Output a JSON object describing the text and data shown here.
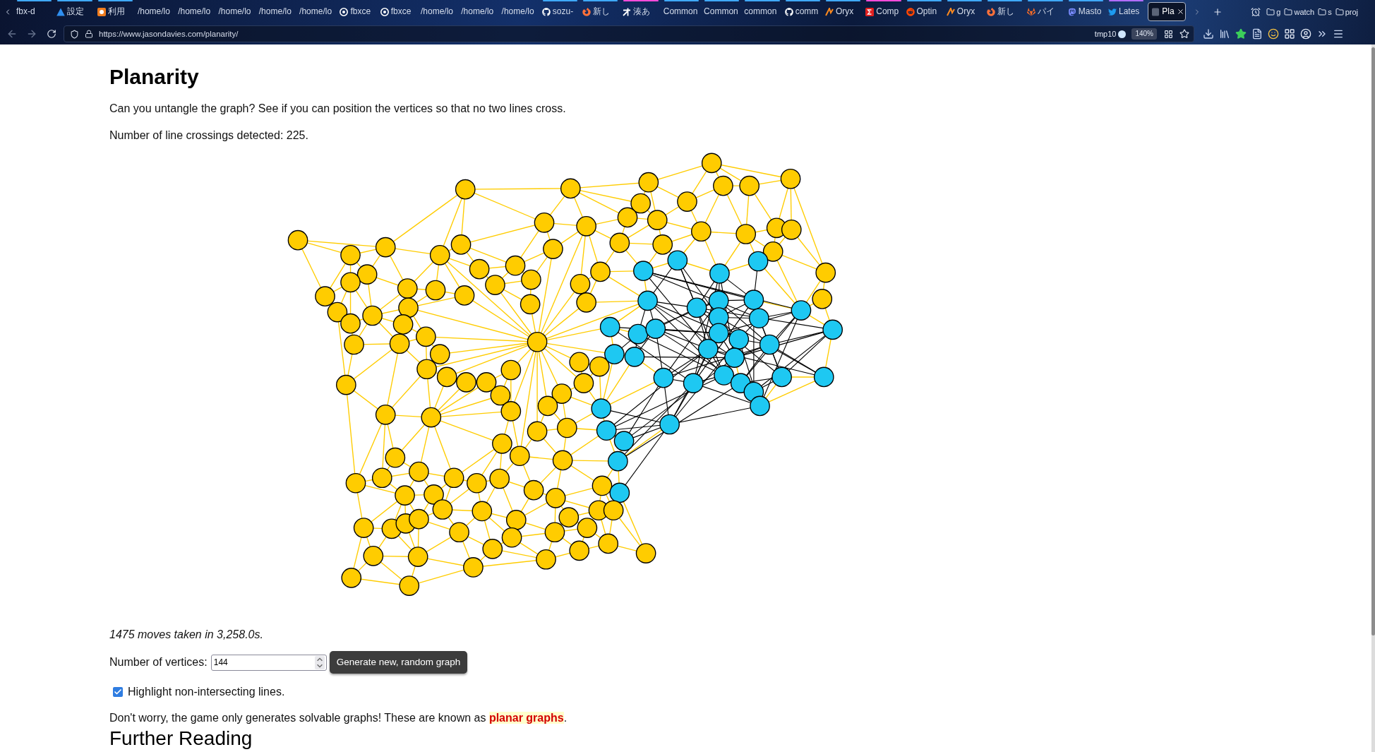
{
  "browser": {
    "tabs": [
      {
        "label": "fbx-d",
        "selected": false,
        "color": "#3fa9ff"
      },
      {
        "label": "設定",
        "selected": false,
        "color": "#3fa9ff"
      },
      {
        "label": "利用",
        "selected": false,
        "color": "#3fa9ff"
      },
      {
        "label": "/home/lo",
        "selected": false
      },
      {
        "label": "/home/lo",
        "selected": false
      },
      {
        "label": "/home/lo",
        "selected": false
      },
      {
        "label": "/home/lo",
        "selected": false
      },
      {
        "label": "/home/lo",
        "selected": false
      },
      {
        "label": "fbxce",
        "selected": false
      },
      {
        "label": "fbxce",
        "selected": false
      },
      {
        "label": "/home/lo",
        "selected": false
      },
      {
        "label": "/home/lo",
        "selected": false
      },
      {
        "label": "/home/lo",
        "selected": false
      },
      {
        "label": "sozu-",
        "selected": false,
        "color": "#3fa9ff"
      },
      {
        "label": "新し",
        "selected": false,
        "color": "#3fa9ff"
      },
      {
        "label": "湊あ",
        "selected": false,
        "color": "#ff4bda"
      },
      {
        "label": "Common",
        "selected": false,
        "color": "#3fa9ff"
      },
      {
        "label": "Common",
        "selected": false,
        "color": "#3fa9ff"
      },
      {
        "label": "common",
        "selected": false,
        "color": "#3fa9ff"
      },
      {
        "label": "comm",
        "selected": false,
        "color": "#3fa9ff"
      },
      {
        "label": "Oryx",
        "selected": false,
        "color": "#3fa9ff"
      },
      {
        "label": "Comp",
        "selected": false,
        "color": "#ff4bda"
      },
      {
        "label": "Optin",
        "selected": false,
        "color": "#3fa9ff"
      },
      {
        "label": "Oryx",
        "selected": false,
        "color": "#3fa9ff"
      },
      {
        "label": "新し",
        "selected": false,
        "color": "#3fa9ff"
      },
      {
        "label": "パイ",
        "selected": false,
        "color": "#3fa9ff"
      },
      {
        "label": "Masto",
        "selected": false,
        "color": "#3fa9ff"
      },
      {
        "label": "Lates",
        "selected": false,
        "color": "#b16cff"
      },
      {
        "label": "Pla",
        "selected": true
      }
    ],
    "bookmarks": [
      "g",
      "watch",
      "s",
      "proj"
    ],
    "url": "https://www.jasondavies.com/planarity/",
    "container": "tmp10",
    "zoom": "140%"
  },
  "page": {
    "title": "Planarity",
    "intro": "Can you untangle the graph? See if you can position the vertices so that no two lines cross.",
    "crossings": "Number of line crossings detected: 225.",
    "moves": "1475 moves taken in 3,258.0s.",
    "vertices": {
      "label": "Number of vertices:",
      "value": "144"
    },
    "generate_button": "Generate new, random graph",
    "highlight": {
      "label": "Highlight non-intersecting lines.",
      "checked": true
    },
    "note": {
      "text": "Don't worry, the game only generates solvable graphs! These are known as",
      "link": "planar graphs",
      "end": "."
    },
    "further_heading": "Further Reading"
  }
}
